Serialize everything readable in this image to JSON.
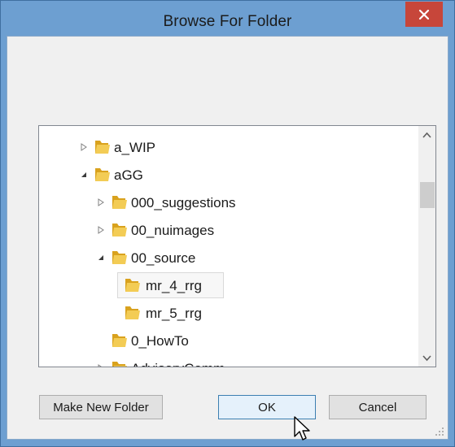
{
  "window": {
    "title": "Browse For Folder",
    "close_glyph": "×"
  },
  "tree": {
    "items": [
      {
        "label": "a_WIP",
        "expander": "collapsed"
      },
      {
        "label": "aGG",
        "expander": "expanded"
      },
      {
        "label": "000_suggestions",
        "expander": "collapsed"
      },
      {
        "label": "00_nuimages",
        "expander": "collapsed"
      },
      {
        "label": "00_source",
        "expander": "expanded"
      },
      {
        "label": "mr_4_rrg",
        "expander": "none",
        "selected": true
      },
      {
        "label": "mr_5_rrg",
        "expander": "none"
      },
      {
        "label": "0_HowTo",
        "expander": "none"
      },
      {
        "label": "AdvisoryComm",
        "expander": "collapsed"
      }
    ]
  },
  "buttons": {
    "make_new_folder": "Make New Folder",
    "ok": "OK",
    "cancel": "Cancel"
  },
  "icons": {
    "folder": "folder-icon",
    "close": "close-icon",
    "cursor": "mouse-pointer-icon"
  },
  "colors": {
    "title_bar": "#6d9fd1",
    "close_button": "#c7463a",
    "folder": "#e9b92f"
  }
}
